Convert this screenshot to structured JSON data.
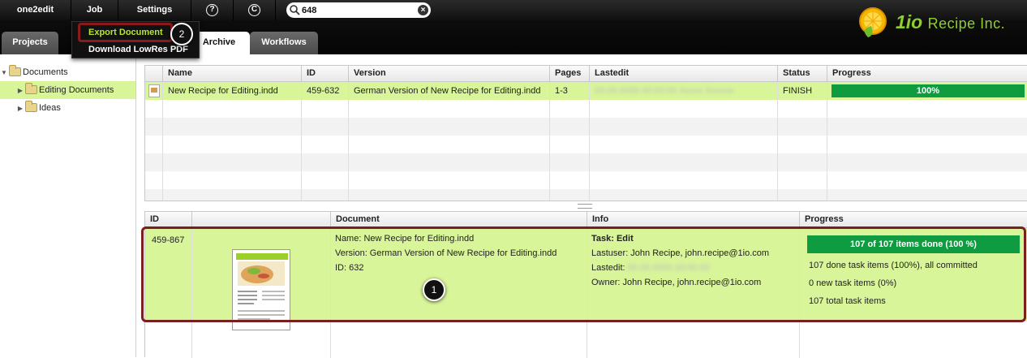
{
  "menubar": {
    "app": "one2edit",
    "job": "Job",
    "settings": "Settings",
    "help_icon": "question-icon",
    "copyright_icon": "copyright-icon",
    "search_value": "648"
  },
  "tabs": [
    "Projects",
    "Archive",
    "Workflows"
  ],
  "dropdown": {
    "items": [
      "Export Document",
      "Download LowRes PDF"
    ]
  },
  "callouts": {
    "one": "1",
    "two": "2"
  },
  "logo": {
    "prefix": "1io",
    "name": "Recipe Inc."
  },
  "tree": {
    "root": "Documents",
    "items": [
      "Editing Documents",
      "Ideas"
    ]
  },
  "top_grid": {
    "columns": [
      "Name",
      "ID",
      "Version",
      "Pages",
      "Lastedit",
      "Status",
      "Progress"
    ],
    "row": {
      "name": "New Recipe for Editing.indd",
      "id": "459-632",
      "version": "German Version of New Recipe for Editing.indd",
      "pages": "1-3",
      "lastedit": "blurred-timestamp",
      "status": "FINISH",
      "progress": "100%"
    }
  },
  "bottom_grid": {
    "columns": [
      "ID",
      "",
      "Document",
      "Info",
      "Progress"
    ],
    "row": {
      "id": "459-867",
      "doc_name": "Name: New Recipe for Editing.indd",
      "doc_version": "Version: German Version of New Recipe for Editing.indd",
      "doc_id": "ID: 632",
      "task": "Task: Edit",
      "lastuser": "Lastuser: John Recipe, john.recipe@1io.com",
      "lastedit_label": "Lastedit:",
      "lastedit_value": "blurred-timestamp",
      "owner": "Owner: John Recipe, john.recipe@1io.com",
      "progress_bar": "107 of 107 items done (100 %)",
      "progress_done": "107 done task items (100%), all committed",
      "progress_new": "0 new task items (0%)",
      "progress_total": "107 total task items"
    }
  },
  "colors": {
    "accent_green": "#0f9b40",
    "selection_green": "#d9f59a",
    "highlight": "#b8e635",
    "outline": "#7a1f1f"
  }
}
